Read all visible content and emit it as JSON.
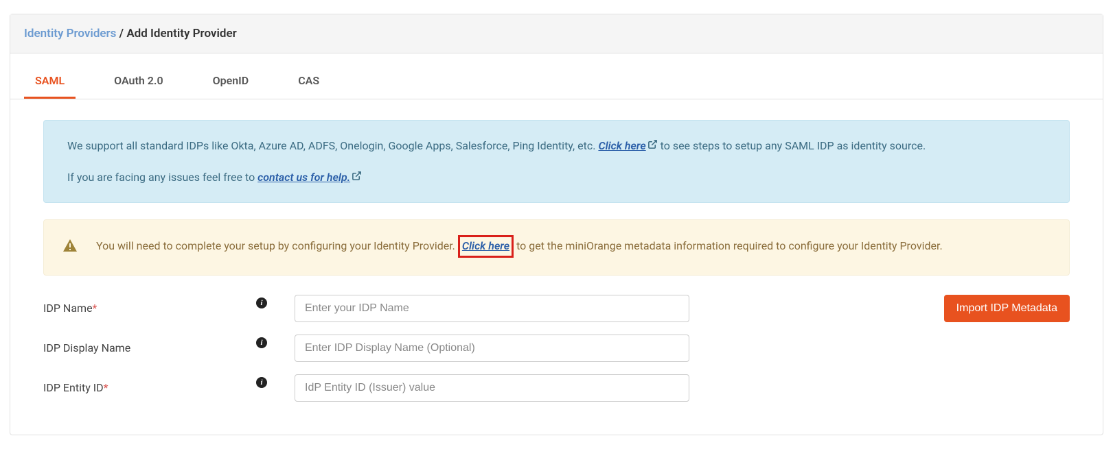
{
  "breadcrumb": {
    "parent": "Identity Providers",
    "separator": " / ",
    "current": "Add Identity Provider"
  },
  "tabs": {
    "saml": "SAML",
    "oauth": "OAuth 2.0",
    "openid": "OpenID",
    "cas": "CAS"
  },
  "info_alert": {
    "line1_a": "We support all standard IDPs like Okta, Azure AD, ADFS, Onelogin, Google Apps, Salesforce, Ping Identity, etc. ",
    "link1": "Click here",
    "line1_b": " to see steps to setup any SAML IDP as identity source.",
    "line2_a": "If you are facing any issues feel free to ",
    "link2": "contact us for help."
  },
  "warn_alert": {
    "text_a": "You will need to complete your setup by configuring your Identity Provider. ",
    "link": "Click here",
    "text_b": " to get the miniOrange metadata information required to configure your Identity Provider."
  },
  "form": {
    "idp_name": {
      "label": "IDP Name",
      "placeholder": "Enter your IDP Name"
    },
    "idp_display": {
      "label": "IDP Display Name",
      "placeholder": "Enter IDP Display Name (Optional)"
    },
    "idp_entity": {
      "label": "IDP Entity ID",
      "placeholder": "IdP Entity ID (Issuer) value"
    }
  },
  "buttons": {
    "import_metadata": "Import IDP Metadata"
  },
  "required_mark": "*"
}
